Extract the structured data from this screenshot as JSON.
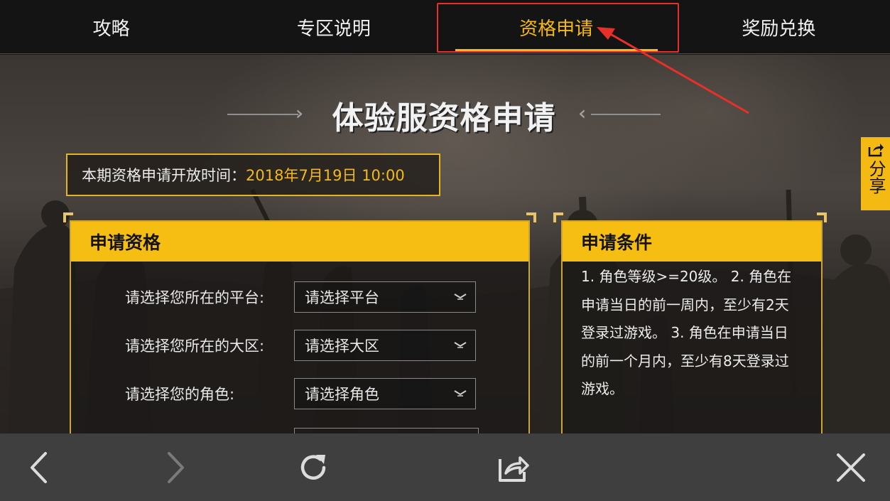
{
  "tabs": [
    {
      "label": "攻略",
      "active": false
    },
    {
      "label": "专区说明",
      "active": false
    },
    {
      "label": "资格申请",
      "active": true
    },
    {
      "label": "奖励兑换",
      "active": false
    }
  ],
  "page_title": "体验服资格申请",
  "notice": {
    "label": "本期资格申请开放时间：",
    "value": "2018年7月19日 10:00"
  },
  "apply_panel": {
    "title": "申请资格",
    "rows": [
      {
        "label": "请选择您所在的平台:",
        "value": "请选择平台"
      },
      {
        "label": "请选择您所在的大区:",
        "value": "请选择大区"
      },
      {
        "label": "请选择您的角色:",
        "value": "请选择角色"
      }
    ]
  },
  "conditions_panel": {
    "title": "申请条件",
    "text": "1. 角色等级>=20级。 2. 角色在申请当日的前一周内，至少有2天登录过游戏。 3. 角色在申请当日的前一个月内，至少有8天登录过游戏。"
  },
  "share": {
    "label": "分享",
    "icon": "share-icon"
  },
  "bottom_bar": {
    "icons": [
      "back-arrow-icon",
      "forward-arrow-icon",
      "refresh-icon",
      "share-out-icon",
      "close-icon"
    ]
  },
  "colors": {
    "accent": "#f5b914",
    "annotation": "#e8302a",
    "topbar": "#141414",
    "bottombar": "#3f3f3f"
  }
}
